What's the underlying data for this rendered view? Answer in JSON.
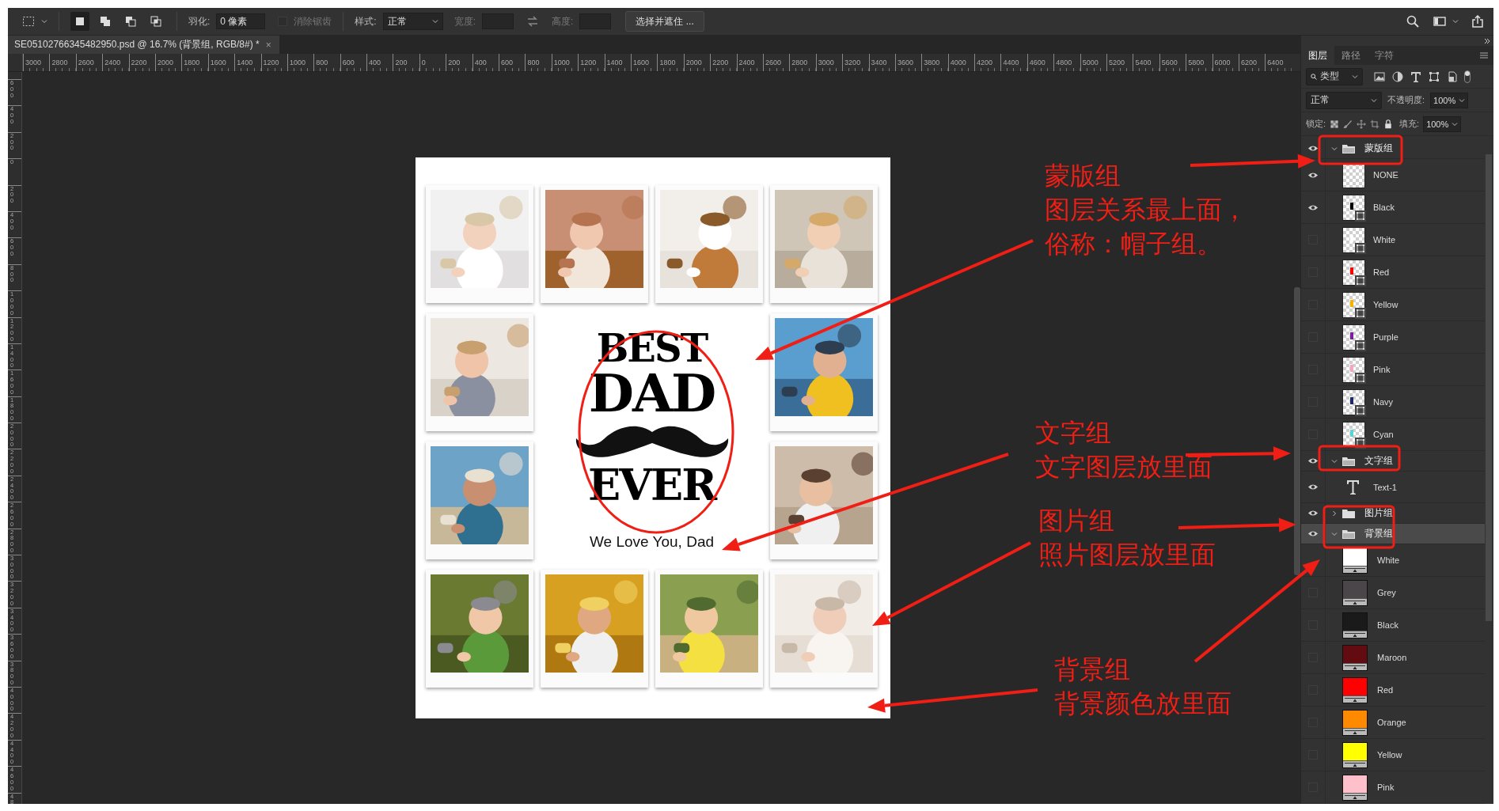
{
  "options_bar": {
    "selection_modes": [
      {
        "selected": true
      },
      {
        "selected": false
      },
      {
        "selected": false
      },
      {
        "selected": false
      }
    ],
    "feather_label": "羽化:",
    "feather_value": "0 像素",
    "antialias": {
      "label": "消除锯齿",
      "checked": false,
      "disabled": true
    },
    "style_label": "样式:",
    "style_value": "正常",
    "width_label": "宽度:",
    "height_label": "高度:",
    "select_mask_button": "选择并遮住 ..."
  },
  "document_tab": {
    "title": "SE05102766345482950.psd @ 16.7% (背景组, RGB/8#) *",
    "close": "×"
  },
  "ruler": {
    "horizontal": [
      "3000",
      "2800",
      "2600",
      "2400",
      "2200",
      "2000",
      "1800",
      "1600",
      "1400",
      "1200",
      "1000",
      "800",
      "600",
      "400",
      "200",
      "0",
      "200",
      "400",
      "600",
      "800",
      "1000",
      "1200",
      "1400",
      "1600",
      "1800",
      "2000",
      "2200",
      "2400",
      "2600",
      "2800",
      "3000",
      "3200",
      "3400",
      "3600",
      "3800",
      "4000",
      "4200",
      "4400",
      "4600",
      "4800",
      "5000",
      "5200",
      "5400",
      "5600",
      "5800",
      "6000",
      "6200",
      "6400"
    ],
    "vertical": [
      "600",
      "400",
      "200",
      "0",
      "200",
      "400",
      "600",
      "800",
      "1000",
      "1200",
      "1400",
      "1600",
      "1800",
      "2000",
      "2200",
      "2400",
      "2600",
      "2800",
      "3000",
      "3200",
      "3400",
      "3600",
      "3800",
      "4000",
      "4200",
      "4400",
      "4600",
      "48"
    ]
  },
  "poster": {
    "photos": [
      {
        "kind": "picture"
      },
      {
        "kind": "picture"
      },
      {
        "kind": "picture"
      },
      {
        "kind": "picture"
      },
      {
        "kind": "picture"
      },
      {
        "kind": "picture"
      },
      {
        "kind": "picture"
      },
      {
        "kind": "picture"
      },
      {
        "kind": "picture"
      },
      {
        "kind": "picture"
      },
      {
        "kind": "picture"
      },
      {
        "kind": "picture"
      }
    ],
    "headline": [
      "BEST",
      "DAD",
      "EVER"
    ],
    "tagline": "We Love You, Dad"
  },
  "annotations": [
    {
      "lines": [
        "蒙版组",
        "图层关系最上面，",
        "俗称：帽子组。"
      ]
    },
    {
      "lines": [
        "文字组",
        "文字图层放里面"
      ]
    },
    {
      "lines": [
        "图片组",
        "照片图层放里面"
      ]
    },
    {
      "lines": [
        "背景组",
        "背景颜色放里面"
      ]
    }
  ],
  "layers_panel": {
    "tabs": [
      {
        "label": "图层",
        "selected": true
      },
      {
        "label": "路径",
        "selected": false
      },
      {
        "label": "字符",
        "selected": false
      }
    ],
    "filter": "类型",
    "blend_mode": "正常",
    "opacity_label": "不透明度:",
    "opacity": "100%",
    "lock_label": "锁定:",
    "fill_label": "填充:",
    "fill": "100%",
    "layers": [
      {
        "kind": "group",
        "name": "蒙版组",
        "visible": true,
        "selected": false,
        "expanded": true,
        "children": [
          {
            "kind": "mask",
            "name": "NONE",
            "visible": true,
            "selected": false
          },
          {
            "kind": "mask",
            "name": "Black",
            "visible": true,
            "selected": false,
            "color": "#000000"
          },
          {
            "kind": "mask",
            "name": "White",
            "visible": false,
            "selected": false,
            "color": "#ffffff"
          },
          {
            "kind": "mask",
            "name": "Red",
            "visible": false,
            "selected": false,
            "color": "#ff0000"
          },
          {
            "kind": "mask",
            "name": "Yellow",
            "visible": false,
            "selected": false,
            "color": "#f5b400"
          },
          {
            "kind": "mask",
            "name": "Purple",
            "visible": false,
            "selected": false,
            "color": "#7a1fa2"
          },
          {
            "kind": "mask",
            "name": "Pink",
            "visible": false,
            "selected": false,
            "color": "#f4a6c0"
          },
          {
            "kind": "mask",
            "name": "Navy",
            "visible": false,
            "selected": false,
            "color": "#1b2a6b"
          },
          {
            "kind": "mask",
            "name": "Cyan",
            "visible": false,
            "selected": false,
            "color": "#5ad6d0"
          }
        ]
      },
      {
        "kind": "group",
        "name": "文字组",
        "visible": true,
        "selected": false,
        "expanded": true,
        "children": [
          {
            "kind": "text",
            "name": "Text-1",
            "visible": true,
            "selected": false
          }
        ]
      },
      {
        "kind": "group",
        "name": "图片组",
        "visible": true,
        "selected": false,
        "expanded": false
      },
      {
        "kind": "group",
        "name": "背景组",
        "visible": true,
        "selected": true,
        "expanded": true,
        "children": [
          {
            "kind": "fill",
            "name": "White",
            "selected": false,
            "color": "#ffffff"
          },
          {
            "kind": "fill",
            "name": "Grey",
            "visible": false,
            "selected": false,
            "color": "#4a4649"
          },
          {
            "kind": "fill",
            "name": "Black",
            "visible": false,
            "selected": false,
            "color": "#1a1a1a"
          },
          {
            "kind": "fill",
            "name": "Maroon",
            "visible": false,
            "selected": false,
            "color": "#620c12"
          },
          {
            "kind": "fill",
            "name": "Red",
            "visible": false,
            "selected": false,
            "color": "#ff0000"
          },
          {
            "kind": "fill",
            "name": "Orange",
            "visible": false,
            "selected": false,
            "color": "#ff8a00"
          },
          {
            "kind": "fill",
            "name": "Yellow",
            "visible": false,
            "selected": false,
            "color": "#ffff00"
          },
          {
            "kind": "fill",
            "name": "Pink",
            "visible": false,
            "selected": false,
            "color": "#ffc0cb"
          }
        ]
      }
    ]
  }
}
